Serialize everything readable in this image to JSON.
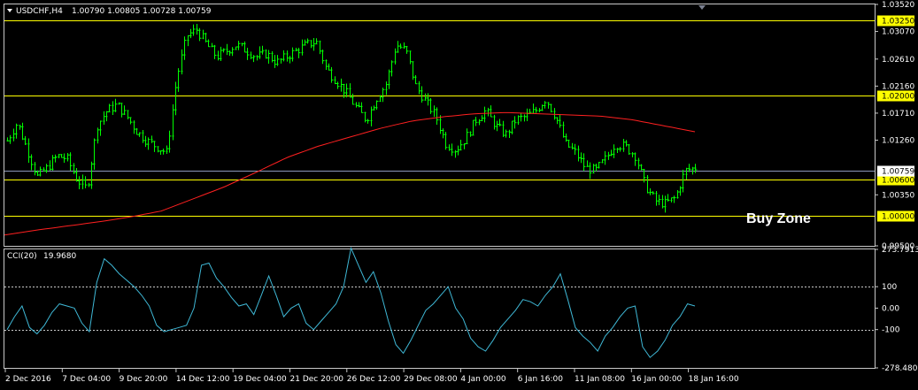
{
  "header": {
    "symbol": "USDCHF,H4",
    "ohlc": "1.00790 1.00805 1.00728 1.00759"
  },
  "annotation": {
    "text": "Buy Zone"
  },
  "colors": {
    "background": "#000000",
    "candles": "#00ff00",
    "ma": "#ff2020",
    "levels": "#ffff00",
    "cci": "#3fb8d6",
    "axis_text": "#ffffff",
    "price_line": "#8c98b8"
  },
  "chart_data": [
    {
      "type": "candlestick",
      "symbol": "USDCHF",
      "timeframe": "H4",
      "ylim": [
        0.995,
        1.0352
      ],
      "y_ticks": [
        "1.03520",
        "1.03070",
        "1.02610",
        "1.02160",
        "1.01710",
        "1.01260",
        "1.00350",
        "0.99500"
      ],
      "x_ticks": [
        "2 Dec 2016",
        "7 Dec 04:00",
        "9 Dec 20:00",
        "14 Dec 12:00",
        "19 Dec 04:00",
        "21 Dec 20:00",
        "26 Dec 12:00",
        "29 Dec 08:00",
        "4 Jan 00:00",
        "6 Jan 16:00",
        "11 Jan 08:00",
        "16 Jan 00:00",
        "18 Jan 16:00"
      ],
      "current_price": "1.00759",
      "levels": [
        "1.03250",
        "1.02000",
        "1.00600",
        "1.00000"
      ],
      "close_profile": [
        1.0125,
        1.0155,
        1.011,
        1.0065,
        1.008,
        1.01,
        1.0095,
        1.006,
        1.0045,
        1.015,
        1.0175,
        1.0185,
        1.0165,
        1.014,
        1.0125,
        1.0115,
        1.0105,
        1.023,
        1.03,
        1.031,
        1.0285,
        1.0265,
        1.0275,
        1.0285,
        1.0275,
        1.0265,
        1.027,
        1.0255,
        1.0265,
        1.0275,
        1.0285,
        1.029,
        1.0245,
        1.0225,
        1.0205,
        1.018,
        1.016,
        1.0195,
        1.022,
        1.0285,
        1.0275,
        1.0215,
        1.019,
        1.0165,
        1.012,
        1.011,
        1.013,
        1.016,
        1.0175,
        1.015,
        1.0135,
        1.016,
        1.0165,
        1.0175,
        1.0195,
        1.0165,
        1.012,
        1.0105,
        1.008,
        1.0075,
        1.0095,
        1.012,
        1.0115,
        1.01,
        1.005,
        1.0025,
        1.002,
        1.003,
        1.0075,
        1.008
      ],
      "ma_profile": [
        0.9968,
        0.9976,
        0.9983,
        0.999,
        0.9998,
        1.0008,
        1.0028,
        1.0048,
        1.0072,
        1.0097,
        1.0116,
        1.0131,
        1.0146,
        1.0158,
        1.0165,
        1.017,
        1.0172,
        1.017,
        1.0168,
        1.0166,
        1.016,
        1.015,
        1.014
      ]
    },
    {
      "type": "line",
      "name": "CCI(20)",
      "value_label": "19.9680",
      "ylim": [
        -278.4808,
        273.7913
      ],
      "y_ticks": [
        "273.7913",
        "100",
        "0.00",
        "-100",
        "-278.4808"
      ],
      "values": [
        -100,
        -40,
        10,
        -90,
        -120,
        -80,
        -20,
        20,
        10,
        0,
        -70,
        -110,
        120,
        230,
        200,
        160,
        130,
        100,
        60,
        10,
        -80,
        -110,
        -100,
        -90,
        -80,
        0,
        200,
        210,
        140,
        100,
        50,
        10,
        20,
        -30,
        60,
        150,
        60,
        -40,
        0,
        20,
        -70,
        -100,
        -60,
        -20,
        20,
        100,
        280,
        200,
        120,
        170,
        70,
        -60,
        -170,
        -210,
        -150,
        -80,
        -10,
        20,
        60,
        100,
        0,
        -50,
        -140,
        -180,
        -200,
        -150,
        -90,
        -50,
        -10,
        40,
        30,
        10,
        60,
        100,
        160,
        40,
        -90,
        -130,
        -160,
        -200,
        -130,
        -90,
        -40,
        0,
        10,
        -180,
        -230,
        -200,
        -150,
        -80,
        -40,
        20,
        10
      ]
    }
  ]
}
